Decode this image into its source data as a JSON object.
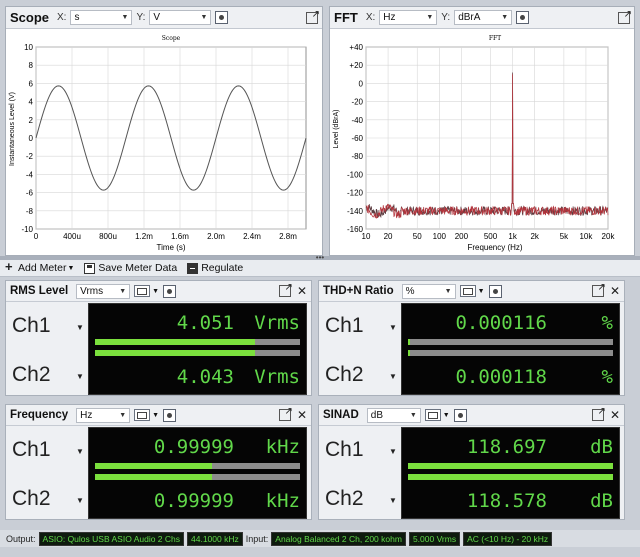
{
  "scope": {
    "title": "Scope",
    "x_tag": "X:",
    "x_unit": "s",
    "y_tag": "Y:",
    "y_unit": "V",
    "chart_title": "Scope",
    "ylabel": "Instantaneous Level (V)",
    "xlabel": "Time (s)",
    "y_ticks": [
      "10",
      "8",
      "6",
      "4",
      "2",
      "0",
      "-2",
      "-4",
      "-6",
      "-8",
      "-10"
    ],
    "x_ticks": [
      "0",
      "400u",
      "800u",
      "1.2m",
      "1.6m",
      "2.0m",
      "2.4m",
      "2.8m"
    ]
  },
  "fft": {
    "title": "FFT",
    "x_tag": "X:",
    "x_unit": "Hz",
    "y_tag": "Y:",
    "y_unit": "dBrA",
    "chart_title": "FFT",
    "ylabel": "Level (dBrA)",
    "xlabel": "Frequency (Hz)",
    "y_ticks": [
      "+40",
      "+20",
      "0",
      "-20",
      "-40",
      "-60",
      "-80",
      "-100",
      "-120",
      "-140",
      "-160"
    ],
    "x_ticks": [
      "10",
      "20",
      "50",
      "100",
      "200",
      "500",
      "1k",
      "2k",
      "5k",
      "10k",
      "20k"
    ]
  },
  "chart_data": [
    {
      "type": "line",
      "title": "Scope",
      "xlabel": "Time (s)",
      "ylabel": "Instantaneous Level (V)",
      "xlim": [
        0,
        0.003
      ],
      "ylim": [
        -10,
        10
      ],
      "series": [
        {
          "frequency_hz": 1000,
          "amplitude": 5.73,
          "phase": "sine"
        }
      ],
      "grid": true
    },
    {
      "type": "line",
      "title": "FFT",
      "xlabel": "Frequency (Hz)",
      "ylabel": "Level (dBrA)",
      "xlim": [
        10,
        20000
      ],
      "ylim": [
        -160,
        40
      ],
      "x_scale": "log",
      "series": [
        {
          "peak_frequency_hz": 1000,
          "peak_level": 12,
          "noise_floor": -140
        }
      ],
      "grid": true
    }
  ],
  "toolbar": {
    "add_meter": "Add Meter",
    "save_meter_data": "Save Meter Data",
    "regulate": "Regulate"
  },
  "meters": {
    "rms": {
      "title": "RMS Level",
      "unit_select": "Vrms",
      "ch1": {
        "label": "Ch1",
        "value": "4.051",
        "unit": "Vrms",
        "fill": 0.78
      },
      "ch2": {
        "label": "Ch2",
        "value": "4.043",
        "unit": "Vrms",
        "fill": 0.78
      }
    },
    "thd": {
      "title": "THD+N Ratio",
      "unit_select": "%",
      "ch1": {
        "label": "Ch1",
        "value": "0.000116",
        "unit": "%",
        "fill": 0.01
      },
      "ch2": {
        "label": "Ch2",
        "value": "0.000118",
        "unit": "%",
        "fill": 0.01
      }
    },
    "freq": {
      "title": "Frequency",
      "unit_select": "Hz",
      "ch1": {
        "label": "Ch1",
        "value": "0.99999",
        "unit": "kHz",
        "fill": 0.57
      },
      "ch2": {
        "label": "Ch2",
        "value": "0.99999",
        "unit": "kHz",
        "fill": 0.57
      }
    },
    "sinad": {
      "title": "SINAD",
      "unit_select": "dB",
      "ch1": {
        "label": "Ch1",
        "value": "118.697",
        "unit": "dB",
        "fill": 1.0
      },
      "ch2": {
        "label": "Ch2",
        "value": "118.578",
        "unit": "dB",
        "fill": 1.0
      }
    }
  },
  "status": {
    "output_label": "Output:",
    "output_device": "ASIO: Qulos USB ASIO Audio 2 Chs",
    "output_rate": "44.1000 kHz",
    "input_label": "Input:",
    "input_device": "Analog Balanced 2 Ch, 200 kohm",
    "input_range": "5.000 Vrms",
    "input_filter": "AC (<10 Hz) - 20 kHz"
  },
  "colors": {
    "lcd_text": "#61d84a",
    "bar_fill": "#7be03d",
    "fft_trace": "#b3343c",
    "scope_trace": "#555555"
  }
}
